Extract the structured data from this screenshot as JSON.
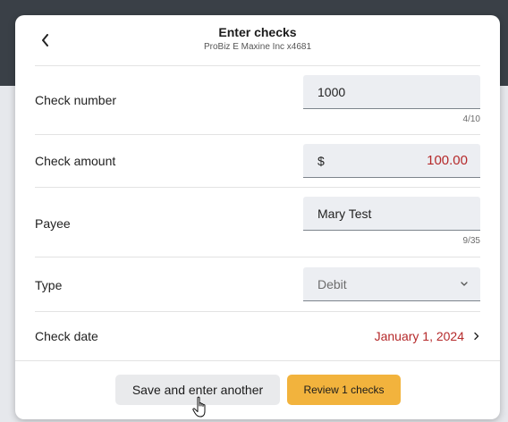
{
  "modal": {
    "title": "Enter checks",
    "subtitle": "ProBiz E Maxine Inc x4681",
    "back_icon": "chevron-left-icon"
  },
  "fields": {
    "check_number": {
      "label": "Check number",
      "value": "1000",
      "counter": "4/10"
    },
    "check_amount": {
      "label": "Check amount",
      "currency": "$",
      "value": "100.00"
    },
    "payee": {
      "label": "Payee",
      "value": "Mary Test",
      "counter": "9/35"
    },
    "type": {
      "label": "Type",
      "selected": "Debit",
      "icon": "chevron-down-icon"
    },
    "check_date": {
      "label": "Check date",
      "value": "January 1, 2024",
      "icon": "chevron-right-icon"
    }
  },
  "actions": {
    "save_another": "Save and enter another",
    "review": "Review 1 checks"
  },
  "colors": {
    "accent": "#f2b33d",
    "value_red": "#b5292a",
    "backdrop_dark": "#3a4047"
  }
}
